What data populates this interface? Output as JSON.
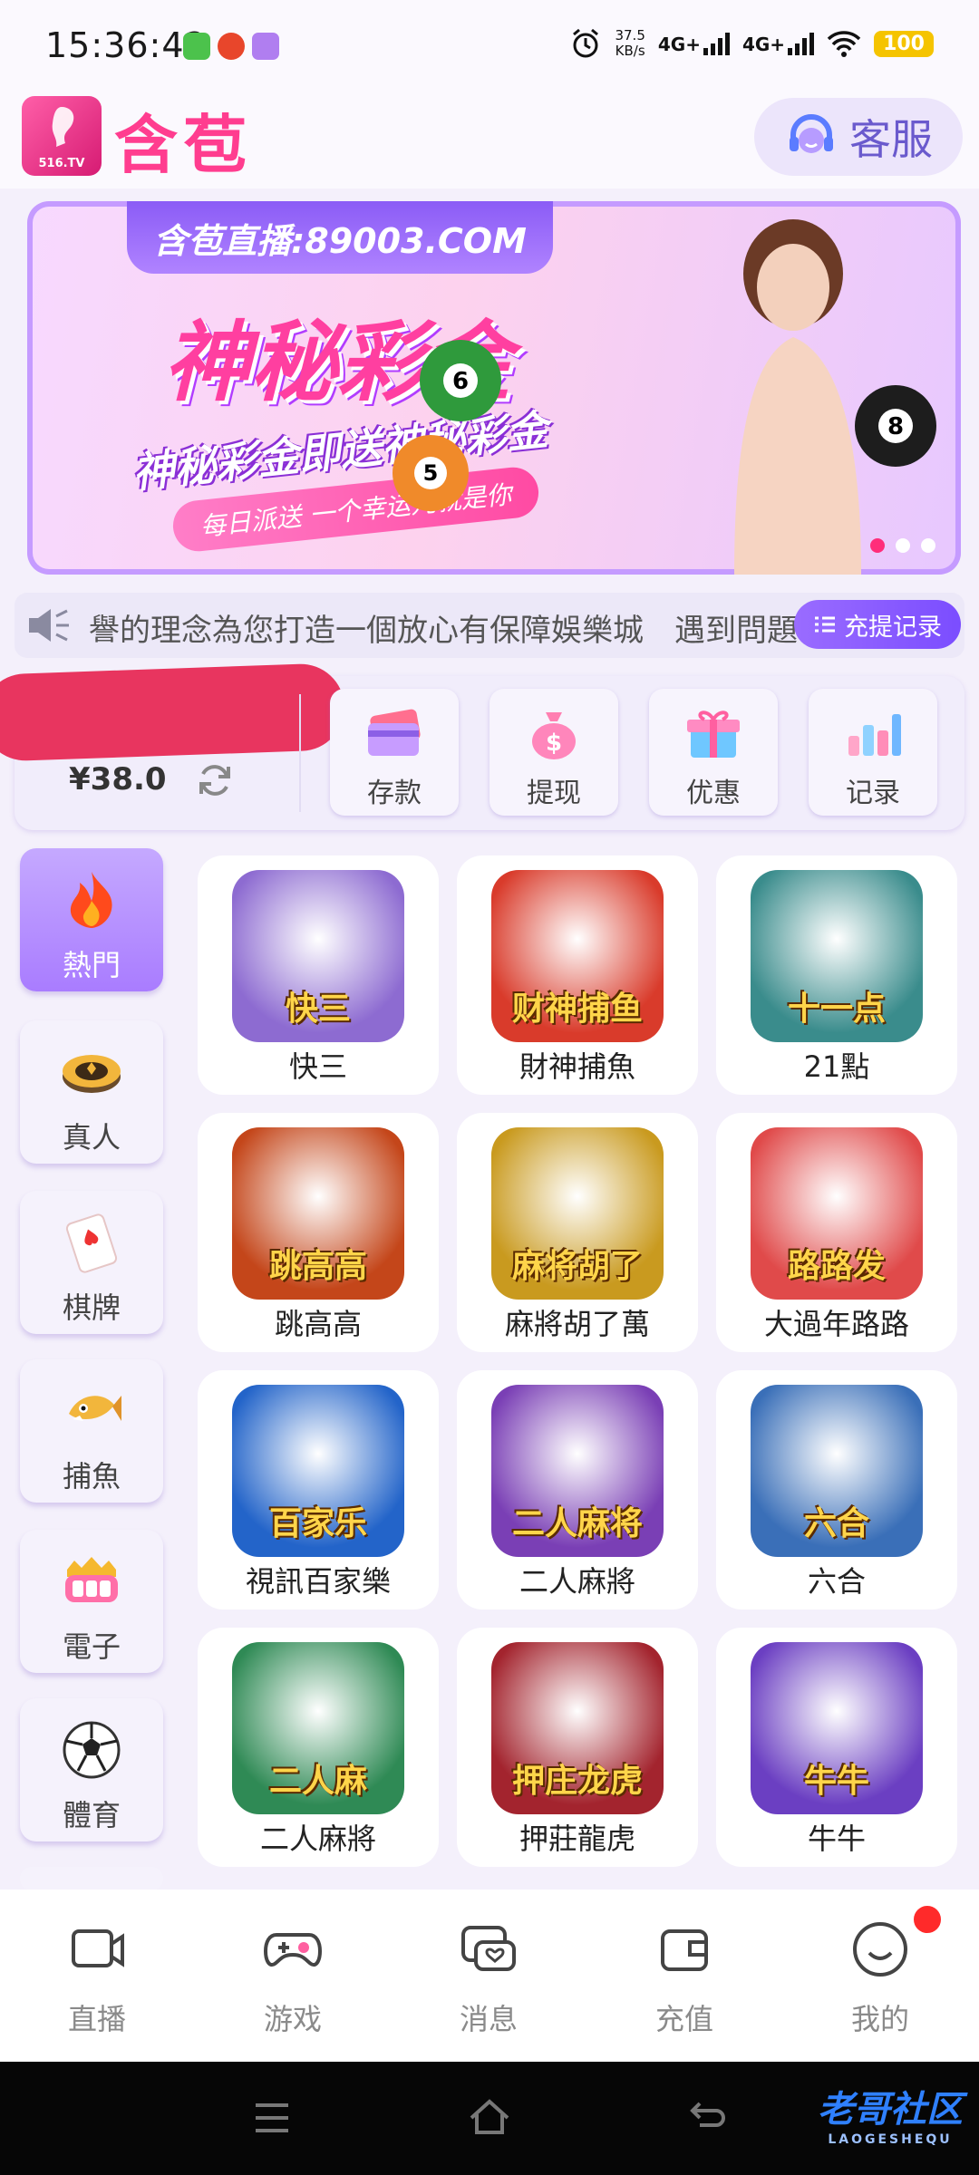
{
  "status_bar": {
    "time": "15:36:42",
    "net_speed_value": "37.5",
    "net_speed_unit": "KB/s",
    "network_1": "4G+",
    "network_2": "4G+",
    "battery": "100"
  },
  "header": {
    "logo_badge": "516.TV",
    "logo_text": "含苞",
    "service_label": "客服"
  },
  "banner": {
    "tag": "含苞直播:89003.COM",
    "title": "神秘彩金",
    "subtitle": "神秘彩金即送神秘彩金",
    "pill": "每日派送  一个幸运儿就是你",
    "active_dot": 0
  },
  "notice": {
    "text": "譽的理念為您打造一個放心有保障娛樂城　遇到問題",
    "records_button": "充提记录"
  },
  "wallet": {
    "balance": "¥38.0",
    "actions": [
      {
        "label": "存款",
        "icon": "card-icon"
      },
      {
        "label": "提现",
        "icon": "money-bag-icon"
      },
      {
        "label": "优惠",
        "icon": "gift-icon"
      },
      {
        "label": "记录",
        "icon": "bar-chart-icon"
      }
    ]
  },
  "categories": [
    {
      "label": "熱門",
      "icon": "fire-icon",
      "active": true
    },
    {
      "label": "真人",
      "icon": "poker-chip-icon",
      "active": false
    },
    {
      "label": "棋牌",
      "icon": "playing-card-icon",
      "active": false
    },
    {
      "label": "捕魚",
      "icon": "fish-icon",
      "active": false
    },
    {
      "label": "電子",
      "icon": "slot-machine-icon",
      "active": false
    },
    {
      "label": "體育",
      "icon": "soccer-ball-icon",
      "active": false
    }
  ],
  "games": [
    {
      "name": "快三",
      "art": "快三",
      "color": "#8d6bd1"
    },
    {
      "name": "財神捕魚",
      "art": "财神捕鱼",
      "color": "#d93b2b"
    },
    {
      "name": "21點",
      "art": "十一点",
      "color": "#3a8c8c"
    },
    {
      "name": "跳高高",
      "art": "跳高高",
      "color": "#c4461a"
    },
    {
      "name": "麻將胡了萬",
      "art": "麻将胡了",
      "color": "#c99a1f"
    },
    {
      "name": "大過年路路",
      "art": "路路发",
      "color": "#e04a4a"
    },
    {
      "name": "視訊百家樂",
      "art": "百家乐",
      "color": "#2364c9"
    },
    {
      "name": "二人麻將",
      "art": "二人麻将",
      "color": "#7a3fb5"
    },
    {
      "name": "六合",
      "art": "六合",
      "color": "#3a6fb8"
    },
    {
      "name": "二人麻將",
      "art": "二人麻",
      "color": "#2f8a55"
    },
    {
      "name": "押莊龍虎",
      "art": "押庄龙虎",
      "color": "#a3242e"
    },
    {
      "name": "牛牛",
      "art": "牛牛",
      "color": "#6b3fc2"
    }
  ],
  "bottom_nav": [
    {
      "label": "直播",
      "icon": "camera-icon"
    },
    {
      "label": "游戏",
      "icon": "gamepad-icon"
    },
    {
      "label": "消息",
      "icon": "chat-icon"
    },
    {
      "label": "充值",
      "icon": "wallet-icon"
    },
    {
      "label": "我的",
      "icon": "profile-icon"
    }
  ],
  "watermark": {
    "text": "老哥社区",
    "sub": "LAOGESHEQU"
  },
  "colors": {
    "accent": "#9a6cff",
    "brand_pink": "#ff3d8f",
    "active_category": "#a97cff",
    "badge_red": "#ff2a2a"
  }
}
